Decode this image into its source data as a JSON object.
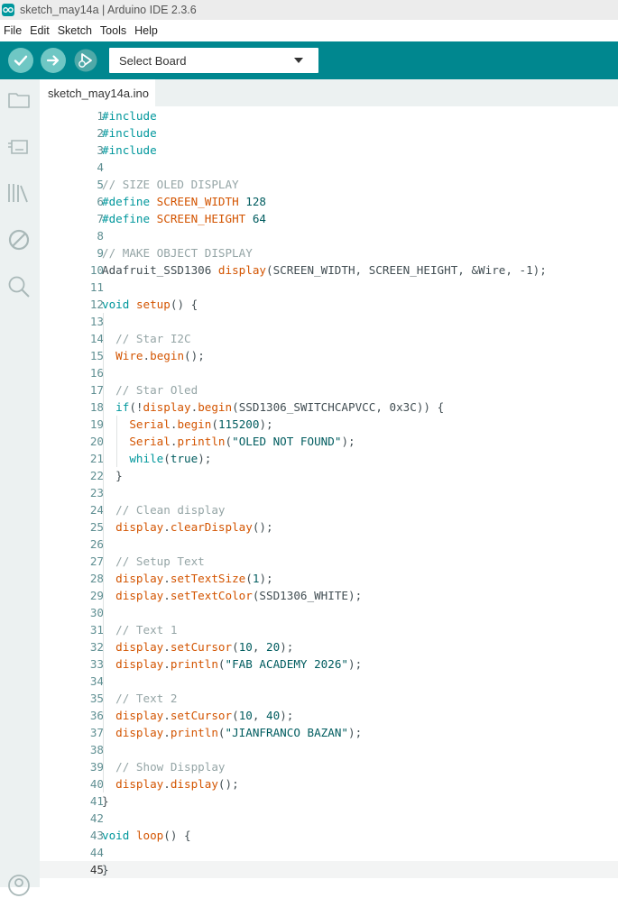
{
  "window": {
    "title": "sketch_may14a | Arduino IDE 2.3.6"
  },
  "menu": {
    "items": [
      "File",
      "Edit",
      "Sketch",
      "Tools",
      "Help"
    ]
  },
  "toolbar": {
    "verify_icon": "checkmark-icon",
    "upload_icon": "arrow-right-icon",
    "debug_icon": "debug-icon",
    "board_select": "Select Board"
  },
  "sidebar": {
    "icons": [
      "folder-icon",
      "board-icon",
      "library-icon",
      "debug-disabled-icon",
      "search-icon",
      "profile-icon"
    ]
  },
  "tabs": [
    {
      "label": "sketch_may14a.ino"
    }
  ],
  "colors": {
    "accent": "#00878f",
    "keyword": "#00979c",
    "function": "#d35400",
    "comment": "#95a5a6"
  },
  "editor": {
    "current_line": 45,
    "lines": [
      {
        "n": "1",
        "tokens": [
          [
            "kw",
            "#include"
          ]
        ]
      },
      {
        "n": "2",
        "tokens": [
          [
            "kw",
            "#include"
          ]
        ]
      },
      {
        "n": "3",
        "tokens": [
          [
            "kw",
            "#include"
          ]
        ]
      },
      {
        "n": "4",
        "tokens": []
      },
      {
        "n": "5",
        "tokens": [
          [
            "comment",
            "// SIZE OLED DISPLAY"
          ]
        ]
      },
      {
        "n": "6",
        "tokens": [
          [
            "kw",
            "#define"
          ],
          [
            "p",
            " "
          ],
          [
            "fn",
            "SCREEN_WIDTH"
          ],
          [
            "p",
            " "
          ],
          [
            "num",
            "128"
          ]
        ]
      },
      {
        "n": "7",
        "tokens": [
          [
            "kw",
            "#define"
          ],
          [
            "p",
            " "
          ],
          [
            "fn",
            "SCREEN_HEIGHT"
          ],
          [
            "p",
            " "
          ],
          [
            "num",
            "64"
          ]
        ]
      },
      {
        "n": "8",
        "tokens": []
      },
      {
        "n": "9",
        "tokens": [
          [
            "comment",
            "// MAKE OBJECT DISPLAY"
          ]
        ]
      },
      {
        "n": "10",
        "tokens": [
          [
            "p",
            "Adafruit_SSD1306 "
          ],
          [
            "fn",
            "display"
          ],
          [
            "p",
            "(SCREEN_WIDTH, SCREEN_HEIGHT, &Wire, -1);"
          ]
        ]
      },
      {
        "n": "11",
        "tokens": []
      },
      {
        "n": "12",
        "tokens": [
          [
            "kw",
            "void"
          ],
          [
            "p",
            " "
          ],
          [
            "fn",
            "setup"
          ],
          [
            "p",
            "() {"
          ]
        ]
      },
      {
        "n": "13",
        "tokens": []
      },
      {
        "n": "14",
        "tokens": [
          [
            "p",
            "  "
          ],
          [
            "comment",
            "// Star I2C"
          ]
        ]
      },
      {
        "n": "15",
        "tokens": [
          [
            "p",
            "  "
          ],
          [
            "fn",
            "Wire"
          ],
          [
            "p",
            "."
          ],
          [
            "fn",
            "begin"
          ],
          [
            "p",
            "();"
          ]
        ]
      },
      {
        "n": "16",
        "tokens": []
      },
      {
        "n": "17",
        "tokens": [
          [
            "p",
            "  "
          ],
          [
            "comment",
            "// Star Oled"
          ]
        ]
      },
      {
        "n": "18",
        "tokens": [
          [
            "p",
            "  "
          ],
          [
            "kw",
            "if"
          ],
          [
            "p",
            "(!"
          ],
          [
            "fn",
            "display"
          ],
          [
            "p",
            "."
          ],
          [
            "fn",
            "begin"
          ],
          [
            "p",
            "(SSD1306_SWITCHCAPVCC, 0x3C)) {"
          ]
        ]
      },
      {
        "n": "19",
        "tokens": [
          [
            "p",
            "    "
          ],
          [
            "fn",
            "Serial"
          ],
          [
            "p",
            "."
          ],
          [
            "fn",
            "begin"
          ],
          [
            "p",
            "("
          ],
          [
            "num",
            "115200"
          ],
          [
            "p",
            ");"
          ]
        ]
      },
      {
        "n": "20",
        "tokens": [
          [
            "p",
            "    "
          ],
          [
            "fn",
            "Serial"
          ],
          [
            "p",
            "."
          ],
          [
            "fn",
            "println"
          ],
          [
            "p",
            "("
          ],
          [
            "str",
            "\"OLED NOT FOUND\""
          ],
          [
            "p",
            ");"
          ]
        ]
      },
      {
        "n": "21",
        "tokens": [
          [
            "p",
            "    "
          ],
          [
            "kw",
            "while"
          ],
          [
            "p",
            "("
          ],
          [
            "num",
            "true"
          ],
          [
            "p",
            ");"
          ]
        ]
      },
      {
        "n": "22",
        "tokens": [
          [
            "p",
            "  }"
          ]
        ]
      },
      {
        "n": "23",
        "tokens": []
      },
      {
        "n": "24",
        "tokens": [
          [
            "p",
            "  "
          ],
          [
            "comment",
            "// Clean display"
          ]
        ]
      },
      {
        "n": "25",
        "tokens": [
          [
            "p",
            "  "
          ],
          [
            "fn",
            "display"
          ],
          [
            "p",
            "."
          ],
          [
            "fn",
            "clearDisplay"
          ],
          [
            "p",
            "();"
          ]
        ]
      },
      {
        "n": "26",
        "tokens": []
      },
      {
        "n": "27",
        "tokens": [
          [
            "p",
            "  "
          ],
          [
            "comment",
            "// Setup Text"
          ]
        ]
      },
      {
        "n": "28",
        "tokens": [
          [
            "p",
            "  "
          ],
          [
            "fn",
            "display"
          ],
          [
            "p",
            "."
          ],
          [
            "fn",
            "setTextSize"
          ],
          [
            "p",
            "("
          ],
          [
            "num",
            "1"
          ],
          [
            "p",
            ");"
          ]
        ]
      },
      {
        "n": "29",
        "tokens": [
          [
            "p",
            "  "
          ],
          [
            "fn",
            "display"
          ],
          [
            "p",
            "."
          ],
          [
            "fn",
            "setTextColor"
          ],
          [
            "p",
            "(SSD1306_WHITE);"
          ]
        ]
      },
      {
        "n": "30",
        "tokens": []
      },
      {
        "n": "31",
        "tokens": [
          [
            "p",
            "  "
          ],
          [
            "comment",
            "// Text 1"
          ]
        ]
      },
      {
        "n": "32",
        "tokens": [
          [
            "p",
            "  "
          ],
          [
            "fn",
            "display"
          ],
          [
            "p",
            "."
          ],
          [
            "fn",
            "setCursor"
          ],
          [
            "p",
            "("
          ],
          [
            "num",
            "10"
          ],
          [
            "p",
            ", "
          ],
          [
            "num",
            "20"
          ],
          [
            "p",
            ");"
          ]
        ]
      },
      {
        "n": "33",
        "tokens": [
          [
            "p",
            "  "
          ],
          [
            "fn",
            "display"
          ],
          [
            "p",
            "."
          ],
          [
            "fn",
            "println"
          ],
          [
            "p",
            "("
          ],
          [
            "str",
            "\"FAB ACADEMY 2026\""
          ],
          [
            "p",
            ");"
          ]
        ]
      },
      {
        "n": "34",
        "tokens": []
      },
      {
        "n": "35",
        "tokens": [
          [
            "p",
            "  "
          ],
          [
            "comment",
            "// Text 2"
          ]
        ]
      },
      {
        "n": "36",
        "tokens": [
          [
            "p",
            "  "
          ],
          [
            "fn",
            "display"
          ],
          [
            "p",
            "."
          ],
          [
            "fn",
            "setCursor"
          ],
          [
            "p",
            "("
          ],
          [
            "num",
            "10"
          ],
          [
            "p",
            ", "
          ],
          [
            "num",
            "40"
          ],
          [
            "p",
            ");"
          ]
        ]
      },
      {
        "n": "37",
        "tokens": [
          [
            "p",
            "  "
          ],
          [
            "fn",
            "display"
          ],
          [
            "p",
            "."
          ],
          [
            "fn",
            "println"
          ],
          [
            "p",
            "("
          ],
          [
            "str",
            "\"JIANFRANCO BAZAN\""
          ],
          [
            "p",
            ");"
          ]
        ]
      },
      {
        "n": "38",
        "tokens": []
      },
      {
        "n": "39",
        "tokens": [
          [
            "p",
            "  "
          ],
          [
            "comment",
            "// Show Dispplay"
          ]
        ]
      },
      {
        "n": "40",
        "tokens": [
          [
            "p",
            "  "
          ],
          [
            "fn",
            "display"
          ],
          [
            "p",
            "."
          ],
          [
            "fn",
            "display"
          ],
          [
            "p",
            "();"
          ]
        ]
      },
      {
        "n": "41",
        "tokens": [
          [
            "p",
            "}"
          ]
        ]
      },
      {
        "n": "42",
        "tokens": []
      },
      {
        "n": "43",
        "tokens": [
          [
            "kw",
            "void"
          ],
          [
            "p",
            " "
          ],
          [
            "fn",
            "loop"
          ],
          [
            "p",
            "() {"
          ]
        ]
      },
      {
        "n": "44",
        "tokens": []
      },
      {
        "n": "45",
        "tokens": [
          [
            "p",
            "}"
          ]
        ]
      }
    ]
  }
}
